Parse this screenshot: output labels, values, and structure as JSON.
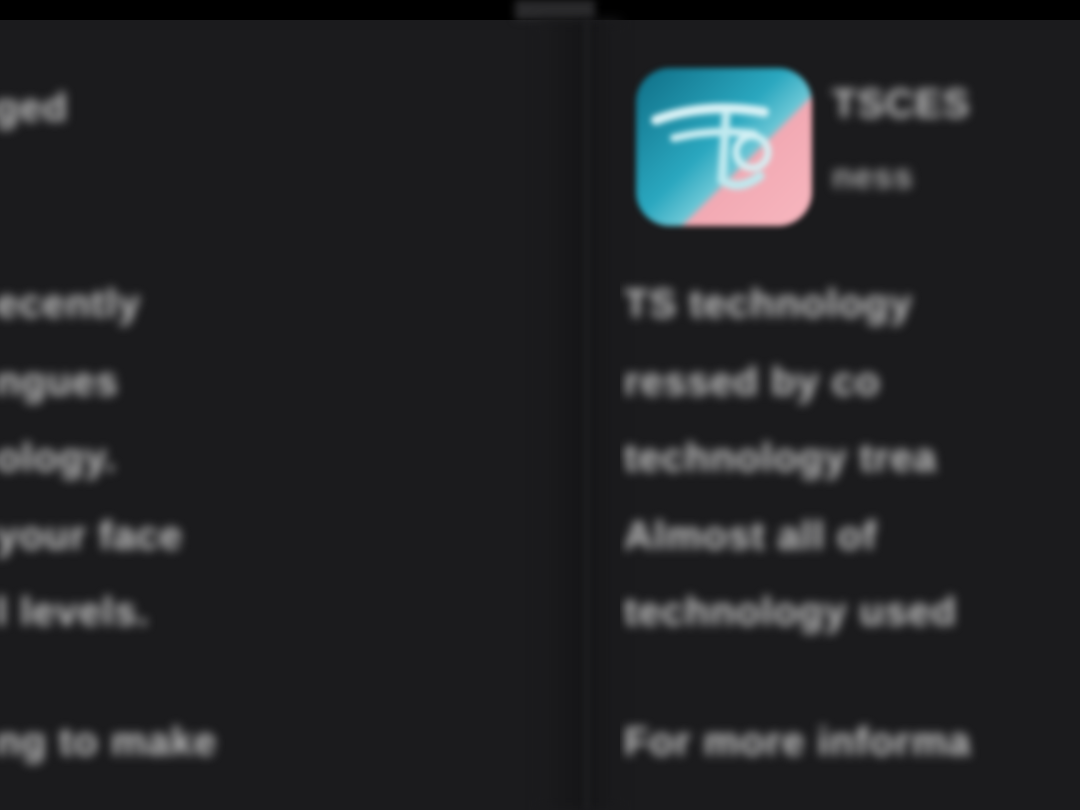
{
  "left_pane": {
    "heading": "ged",
    "lines": [
      "ecently",
      "ngues",
      "ology.",
      "your face",
      "l levels.",
      "ng to make"
    ]
  },
  "right_pane": {
    "app_name": "TSCES",
    "app_subtitle": "ness",
    "lines": [
      "TS technology",
      "ressed by co",
      "technology trea",
      "Almost all of",
      "technology used",
      "For more informa"
    ]
  },
  "colors": {
    "background": "#1b1b1d",
    "text": "#c9c9c9",
    "icon_teal": "#2aa7bf",
    "icon_pink": "#f7b7bf"
  },
  "icons": {
    "app_icon": "stylized-letter-app-icon"
  }
}
